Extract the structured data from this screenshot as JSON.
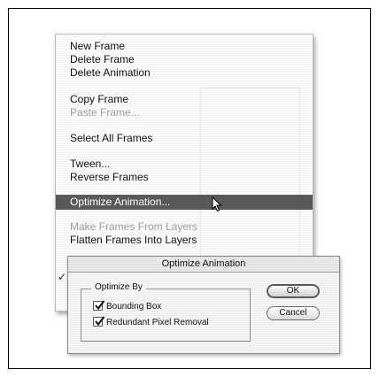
{
  "menu": {
    "items": [
      {
        "label": "New Frame",
        "disabled": false
      },
      {
        "label": "Delete Frame",
        "disabled": false
      },
      {
        "label": "Delete Animation",
        "disabled": false
      },
      {
        "label": "Copy Frame",
        "disabled": false
      },
      {
        "label": "Paste Frame...",
        "disabled": true
      },
      {
        "label": "Select All Frames",
        "disabled": false
      },
      {
        "label": "Tween...",
        "disabled": false
      },
      {
        "label": "Reverse Frames",
        "disabled": false
      },
      {
        "label": "Optimize Animation...",
        "disabled": false,
        "highlighted": true
      },
      {
        "label": "Make Frames From Layers",
        "disabled": true
      },
      {
        "label": "Flatten Frames Into Layers",
        "disabled": false
      }
    ],
    "checkmark": "✓"
  },
  "dialog": {
    "title": "Optimize Animation",
    "group_label": "Optimize By",
    "options": [
      {
        "label": "Bounding Box",
        "checked": true
      },
      {
        "label": "Redundant Pixel Removal",
        "checked": true
      }
    ],
    "ok_label": "OK",
    "cancel_label": "Cancel"
  }
}
